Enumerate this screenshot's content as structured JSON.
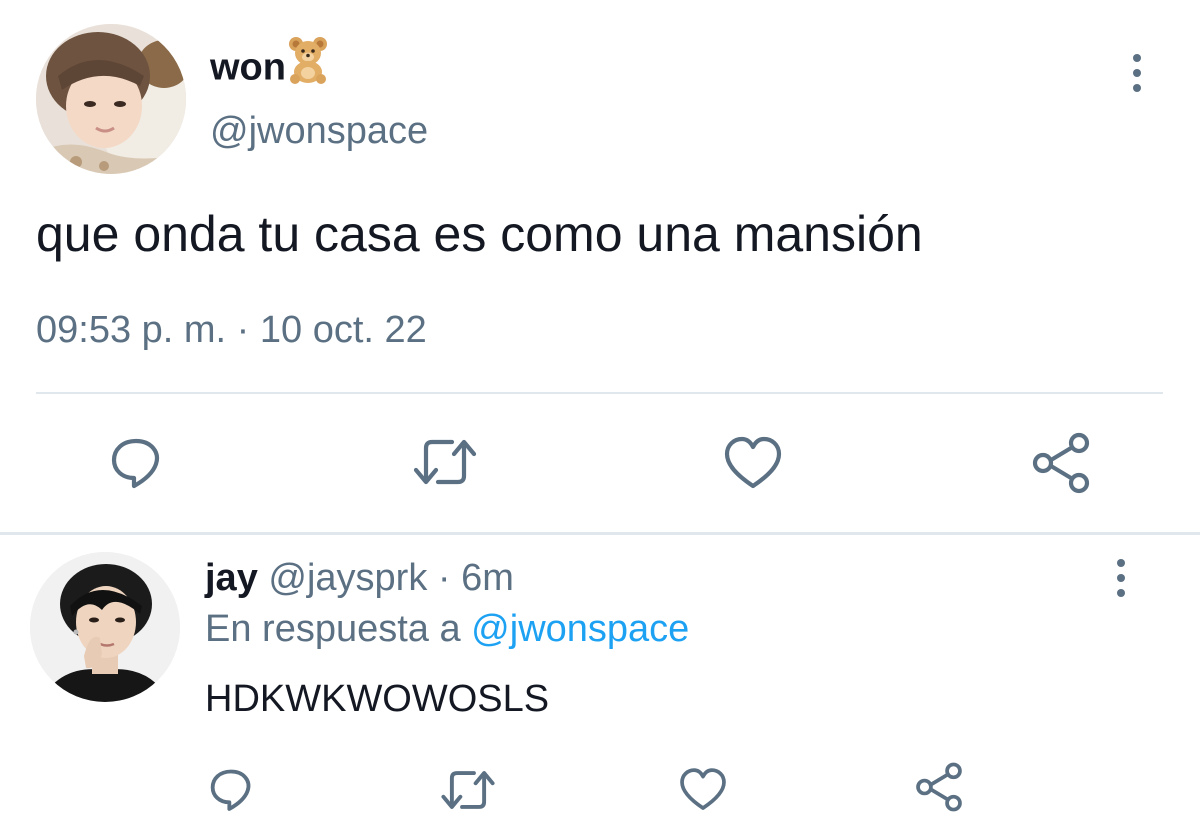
{
  "main_tweet": {
    "author_name": "won",
    "author_emoji_icon": "teddy-bear-icon",
    "author_handle": "@jwonspace",
    "text": "que onda tu casa es como una mansión",
    "timestamp": "09:53 p. m. · 10 oct. 22",
    "actions": [
      "reply-icon",
      "retweet-icon",
      "like-icon",
      "share-icon"
    ]
  },
  "reply": {
    "author_name": "jay",
    "author_handle": "@jaysprk",
    "separator": " · ",
    "time_ago": "6m",
    "replying_to_prefix": "En respuesta a ",
    "replying_to_handle": "@jwonspace",
    "text": "HDKWKWOWOSLS",
    "actions": [
      "reply-icon",
      "retweet-icon",
      "like-icon",
      "share-icon"
    ]
  },
  "colors": {
    "text_primary": "#141823",
    "text_secondary": "#5b7083",
    "link": "#1da1f2",
    "divider": "#e1e8ed",
    "icon": "#5b7083"
  }
}
